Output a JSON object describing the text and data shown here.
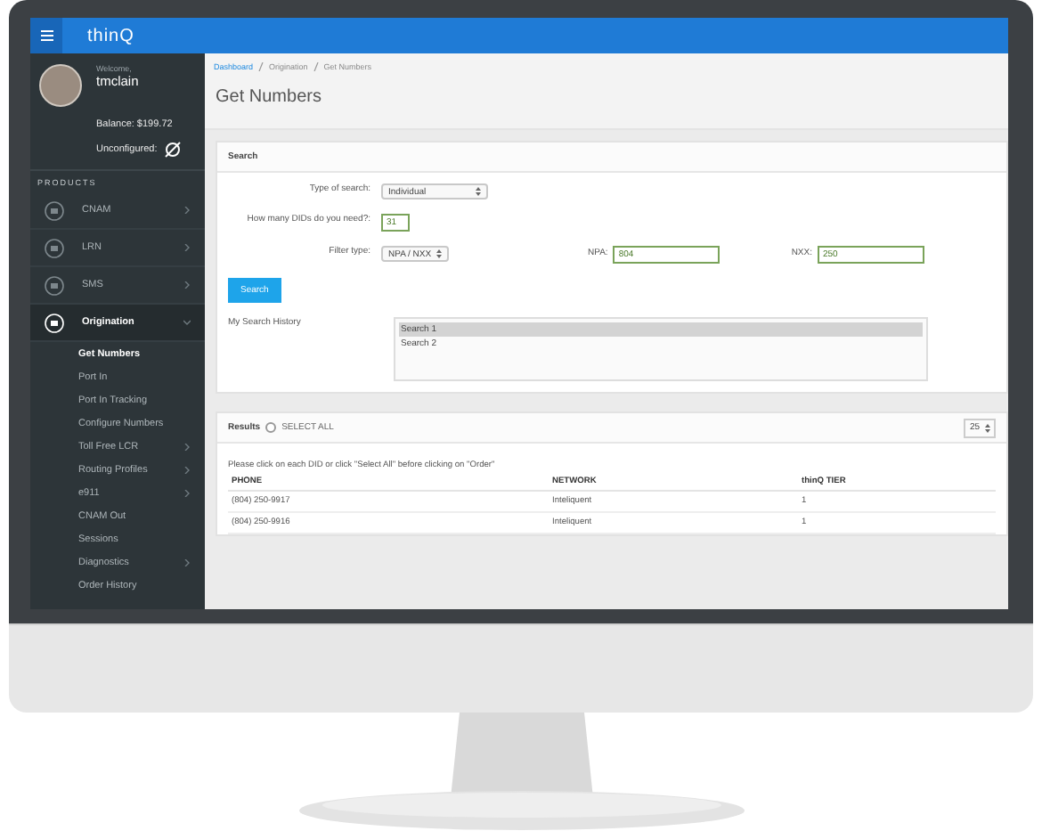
{
  "header": {
    "logo": "thinQ"
  },
  "profile": {
    "welcome": "Welcome,",
    "username": "tmclain",
    "balance": "Balance: $199.72",
    "unconfigured": "Unconfigured:"
  },
  "sidebar": {
    "heading": "PRODUCTS",
    "items": [
      {
        "label": "CNAM",
        "expanded": false
      },
      {
        "label": "LRN",
        "expanded": false
      },
      {
        "label": "SMS",
        "expanded": false
      },
      {
        "label": "Origination",
        "expanded": true,
        "children": [
          {
            "label": "Get Numbers",
            "selected": true,
            "expandable": false
          },
          {
            "label": "Port In",
            "selected": false,
            "expandable": false
          },
          {
            "label": "Port In Tracking",
            "selected": false,
            "expandable": false
          },
          {
            "label": "Configure Numbers",
            "selected": false,
            "expandable": false
          },
          {
            "label": "Toll Free LCR",
            "selected": false,
            "expandable": true
          },
          {
            "label": "Routing Profiles",
            "selected": false,
            "expandable": true
          },
          {
            "label": "e911",
            "selected": false,
            "expandable": true
          },
          {
            "label": "CNAM Out",
            "selected": false,
            "expandable": false
          },
          {
            "label": "Sessions",
            "selected": false,
            "expandable": false
          },
          {
            "label": "Diagnostics",
            "selected": false,
            "expandable": true
          },
          {
            "label": "Order History",
            "selected": false,
            "expandable": false
          }
        ]
      }
    ]
  },
  "breadcrumb": [
    "Dashboard",
    "Origination",
    "Get Numbers"
  ],
  "title": "Get Numbers",
  "search": {
    "heading": "Search",
    "type_label": "Type of search:",
    "type_value": "Individual",
    "count_label": "How many DIDs do you need?:",
    "count_value": "31",
    "filter_label": "Filter type:",
    "filter_value": "NPA / NXX",
    "npa_label": "NPA:",
    "npa_value": "804",
    "nxx_label": "NXX:",
    "nxx_value": "250",
    "button": "Search",
    "history_label": "My Search History",
    "history": [
      {
        "label": "Search 1",
        "selected": true
      },
      {
        "label": "Search 2",
        "selected": false
      }
    ]
  },
  "results": {
    "heading": "Results",
    "select_all": {
      "label": "SELECT ALL",
      "checked": false
    },
    "page_size": "25",
    "instruction": "Please click on each DID or click \"Select All\" before clicking on \"Order\"",
    "columns": [
      "PHONE",
      "NETWORK",
      "thinQ TIER"
    ],
    "rows": [
      [
        "(804) 250-9917",
        "Inteliquent",
        "1"
      ],
      [
        "(804) 250-9916",
        "Inteliquent",
        "1"
      ]
    ]
  }
}
